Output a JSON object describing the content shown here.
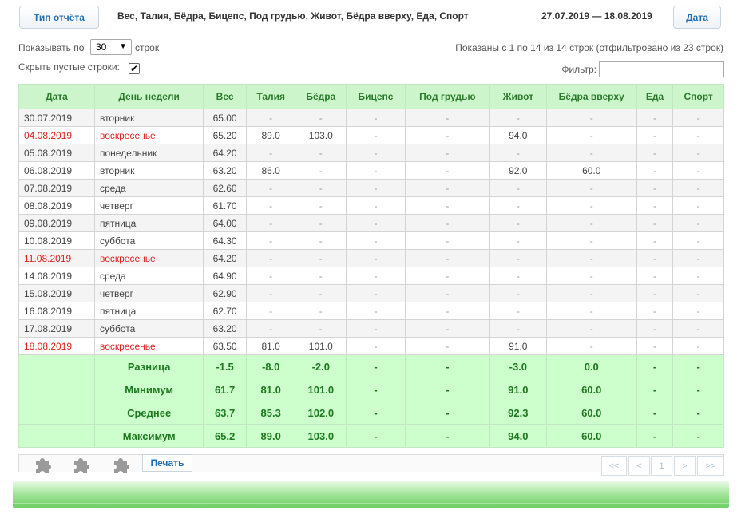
{
  "header": {
    "report_type_label": "Тип отчёта",
    "columns_caption": "Вес, Талия, Бёдра, Бицепс, Под грудью, Живот, Бёдра вверху, Еда, Спорт",
    "date_range": "27.07.2019 — 18.08.2019",
    "date_button_label": "Дата"
  },
  "controls": {
    "show_label": "Показывать по",
    "page_size": "30",
    "rows_suffix": "строк",
    "shown_info": "Показаны с 1 по 14 из 14 строк (отфильтровано из 23 строк)",
    "hide_empty_label": "Скрыть пустые строки:",
    "hide_empty_checked": "✔",
    "filter_label": "Фильтр:",
    "filter_value": ""
  },
  "table": {
    "columns": [
      "Дата",
      "День недели",
      "Вес",
      "Талия",
      "Бёдра",
      "Бицепс",
      "Под грудью",
      "Живот",
      "Бёдра вверху",
      "Еда",
      "Спорт"
    ],
    "rows": [
      [
        "30.07.2019",
        "вторник",
        "65.00",
        "-",
        "-",
        "-",
        "-",
        "-",
        "-",
        "-",
        "-"
      ],
      [
        "04.08.2019",
        "воскресенье",
        "65.20",
        "89.0",
        "103.0",
        "-",
        "-",
        "94.0",
        "-",
        "-",
        "-"
      ],
      [
        "05.08.2019",
        "понедельник",
        "64.20",
        "-",
        "-",
        "-",
        "-",
        "-",
        "-",
        "-",
        "-"
      ],
      [
        "06.08.2019",
        "вторник",
        "63.20",
        "86.0",
        "-",
        "-",
        "-",
        "92.0",
        "60.0",
        "-",
        "-"
      ],
      [
        "07.08.2019",
        "среда",
        "62.60",
        "-",
        "-",
        "-",
        "-",
        "-",
        "-",
        "-",
        "-"
      ],
      [
        "08.08.2019",
        "четверг",
        "61.70",
        "-",
        "-",
        "-",
        "-",
        "-",
        "-",
        "-",
        "-"
      ],
      [
        "09.08.2019",
        "пятница",
        "64.00",
        "-",
        "-",
        "-",
        "-",
        "-",
        "-",
        "-",
        "-"
      ],
      [
        "10.08.2019",
        "суббота",
        "64.30",
        "-",
        "-",
        "-",
        "-",
        "-",
        "-",
        "-",
        "-"
      ],
      [
        "11.08.2019",
        "воскресенье",
        "64.20",
        "-",
        "-",
        "-",
        "-",
        "-",
        "-",
        "-",
        "-"
      ],
      [
        "14.08.2019",
        "среда",
        "64.90",
        "-",
        "-",
        "-",
        "-",
        "-",
        "-",
        "-",
        "-"
      ],
      [
        "15.08.2019",
        "четверг",
        "62.90",
        "-",
        "-",
        "-",
        "-",
        "-",
        "-",
        "-",
        "-"
      ],
      [
        "16.08.2019",
        "пятница",
        "62.70",
        "-",
        "-",
        "-",
        "-",
        "-",
        "-",
        "-",
        "-"
      ],
      [
        "17.08.2019",
        "суббота",
        "63.20",
        "-",
        "-",
        "-",
        "-",
        "-",
        "-",
        "-",
        "-"
      ],
      [
        "18.08.2019",
        "воскресенье",
        "63.50",
        "81.0",
        "101.0",
        "-",
        "-",
        "91.0",
        "-",
        "-",
        "-"
      ]
    ],
    "summary": [
      [
        "",
        "Разница",
        "-1.5",
        "-8.0",
        "-2.0",
        "-",
        "-",
        "-3.0",
        "0.0",
        "-",
        "-"
      ],
      [
        "",
        "Минимум",
        "61.7",
        "81.0",
        "101.0",
        "-",
        "-",
        "91.0",
        "60.0",
        "-",
        "-"
      ],
      [
        "",
        "Среднее",
        "63.7",
        "85.3",
        "102.0",
        "-",
        "-",
        "92.3",
        "60.0",
        "-",
        "-"
      ],
      [
        "",
        "Максимум",
        "65.2",
        "89.0",
        "103.0",
        "-",
        "-",
        "94.0",
        "60.0",
        "-",
        "-"
      ]
    ],
    "sunday_label": "воскресенье"
  },
  "footer": {
    "toolbar_icons": [
      "puzzle-icon",
      "puzzle-icon",
      "puzzle-icon"
    ],
    "print_label": "Печать",
    "pagination": {
      "first": "<<",
      "prev": "<",
      "current": "1",
      "next": ">",
      "last": ">>"
    }
  },
  "colors": {
    "header_bg": "#ccf5cc",
    "header_text": "#2b7a2b",
    "summary_bg": "#ccffcc",
    "sunday_text": "#e02020",
    "link_blue": "#1f6fb2",
    "band_green": "#6ccf63"
  }
}
